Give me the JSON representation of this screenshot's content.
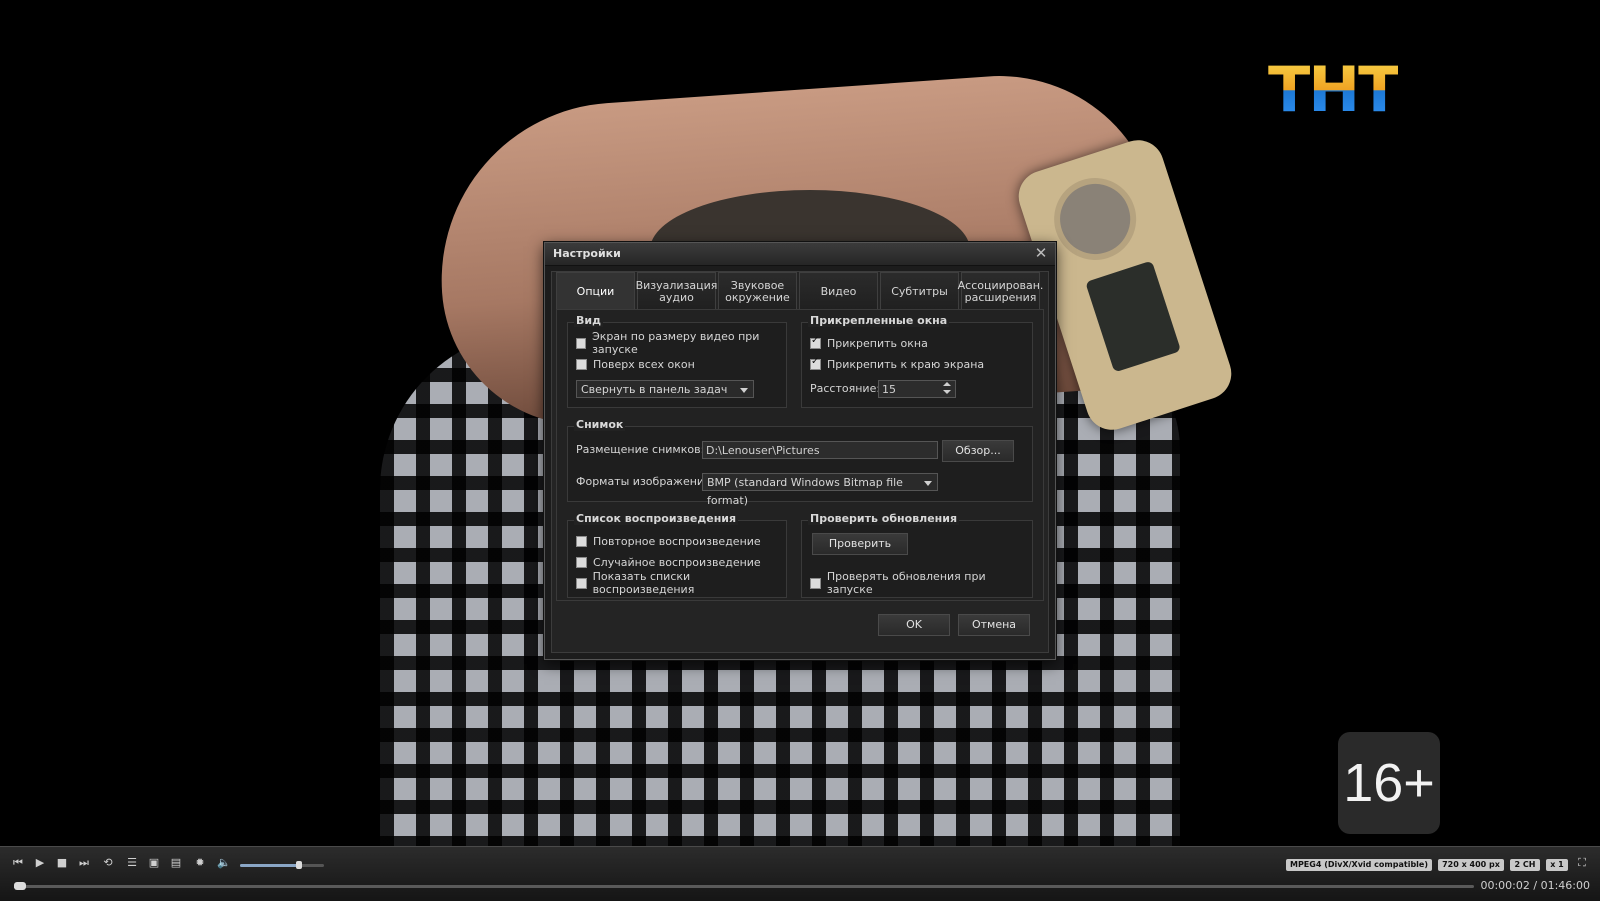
{
  "video": {
    "logo_text": "ТНТ",
    "age_rating": "16+"
  },
  "dialog": {
    "title": "Настройки",
    "close_icon": "close-icon",
    "tabs": [
      {
        "label": "Опции",
        "active": true
      },
      {
        "label": "Визуализация аудио",
        "active": false
      },
      {
        "label": "Звуковое окружение",
        "active": false
      },
      {
        "label": "Видео",
        "active": false
      },
      {
        "label": "Субтитры",
        "active": false
      },
      {
        "label": "Ассоциирован. расширения",
        "active": false
      }
    ],
    "view": {
      "legend": "Вид",
      "fit_screen": {
        "label": "Экран по размеру видео при запуске",
        "checked": false
      },
      "on_top": {
        "label": "Поверх всех окон",
        "checked": false
      },
      "minimize_select": "Свернуть в панель задач"
    },
    "docked": {
      "legend": "Прикрепленные окна",
      "attach_windows": {
        "label": "Прикрепить окна",
        "checked": true
      },
      "attach_edge": {
        "label": "Прикрепить к краю экрана",
        "checked": true
      },
      "distance_label": "Расстояние:",
      "distance_value": "15"
    },
    "snapshot": {
      "legend": "Снимок",
      "location_label": "Размещение снимков:",
      "location_value": "D:\\Lenouser\\Pictures",
      "browse_label": "Обзор...",
      "format_label": "Форматы изображений:",
      "format_value": "BMP (standard Windows Bitmap file format)"
    },
    "playlist": {
      "legend": "Список воспроизведения",
      "repeat": {
        "label": "Повторное воспроизведение",
        "checked": false
      },
      "shuffle": {
        "label": "Случайное воспроизведение",
        "checked": false
      },
      "show_lists": {
        "label": "Показать списки воспроизведения",
        "checked": false
      }
    },
    "updates": {
      "legend": "Проверить обновления",
      "check_button": "Проверить",
      "check_on_start": {
        "label": "Проверять обновления при запуске",
        "checked": false
      }
    },
    "ok_label": "OK",
    "cancel_label": "Отмена"
  },
  "player": {
    "icons": [
      "prev-icon",
      "play-icon",
      "stop-icon",
      "next-icon",
      "repeat-icon",
      "playlist-icon",
      "snapshot-icon",
      "settings-icon",
      "brightness-icon",
      "volume-icon"
    ],
    "volume_level": 0.7,
    "codec": "MPEG4 (DivX/Xvid compatible)",
    "resolution": "720 x 400 px",
    "channels": "2 CH",
    "speed": "x 1",
    "progress": 0.0003,
    "time_current": "00:00:02",
    "time_sep": "/",
    "time_total": "01:46:00",
    "fullscreen_icon": "fullscreen-icon"
  }
}
